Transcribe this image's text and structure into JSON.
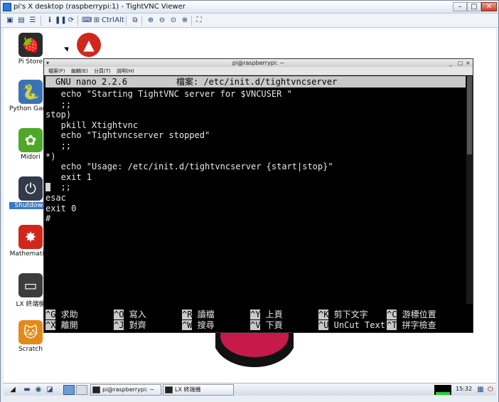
{
  "vnc": {
    "title": "pi's X desktop (raspberrypi:1) - TightVNC Viewer",
    "minimize": "–",
    "maximize": "□",
    "close": "✕",
    "toolbar": {
      "ctrl_label": "Ctrl",
      "alt_label": "Alt"
    }
  },
  "desktop": {
    "icons": [
      {
        "label": "Pi Store",
        "glyph": "🍓",
        "color": "#2c2c2c",
        "selected": false
      },
      {
        "label": "Python Games",
        "glyph": "🐍",
        "color": "#3a73b5",
        "selected": false
      },
      {
        "label": "Midori",
        "glyph": "✿",
        "color": "#4fa82a",
        "selected": false
      },
      {
        "label": "Shutdown",
        "glyph": "⏻",
        "color": "#333b4a",
        "selected": true
      },
      {
        "label": "Mathematica",
        "glyph": "✸",
        "color": "#d0271d",
        "selected": false
      },
      {
        "label": "LX 終端機",
        "glyph": "▭",
        "color": "#3c3c3c",
        "selected": false
      },
      {
        "label": "Scratch",
        "glyph": "🐱",
        "color": "#e48a1c",
        "selected": false
      }
    ]
  },
  "terminal": {
    "title": "pi@raspberrypi: ~",
    "menu": [
      "檔案(F)",
      "編輯(E)",
      "分頁(T)",
      "說明(H)"
    ],
    "nano_version": "GNU nano 2.2.6",
    "file_label": "檔案: /etc/init.d/tightvncserver",
    "code_lines": [
      "   echo \"Starting TightVNC server for $VNCUSER \"",
      "   ;;",
      "stop)",
      "   pkill Xtightvnc",
      "   echo \"Tightvncserver stopped\"",
      "   ;;",
      "*)",
      "   echo \"Usage: /etc/init.d/tightvncserver {start|stop}\"",
      "   exit 1",
      "",
      "esac",
      "exit 0",
      "#"
    ],
    "cursor_line_text": "   ;;",
    "shortcuts": [
      [
        {
          "key": "^G",
          "label": " 求助"
        },
        {
          "key": "^O",
          "label": " 寫入"
        },
        {
          "key": "^R",
          "label": " 讀檔"
        },
        {
          "key": "^Y",
          "label": " 上頁"
        },
        {
          "key": "^K",
          "label": " 剪下文字"
        },
        {
          "key": "^C",
          "label": " 游標位置"
        }
      ],
      [
        {
          "key": "^X",
          "label": " 離開"
        },
        {
          "key": "^J",
          "label": " 對齊"
        },
        {
          "key": "^W",
          "label": " 搜尋"
        },
        {
          "key": "^V",
          "label": " 下頁"
        },
        {
          "key": "^U",
          "label": " UnCut Text"
        },
        {
          "key": "^T",
          "label": " 拼字檢查"
        }
      ]
    ]
  },
  "taskbar": {
    "tasks": [
      "pi@raspberrypi: ~",
      "LX 終端機"
    ],
    "clock": "15:32"
  }
}
